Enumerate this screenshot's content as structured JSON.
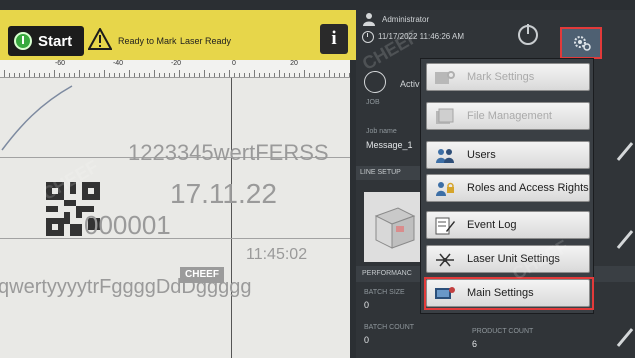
{
  "toolbar": {
    "start_label": "Start",
    "ready_label": "Ready to Mark",
    "laser_label": "Laser Ready",
    "info_label": "i"
  },
  "preview": {
    "ruler_labels": [
      "-60",
      "-40",
      "-20",
      "0",
      "20"
    ],
    "text_code": "1223345wertFERSS",
    "text_date": "17.11.22",
    "text_counter": "000001",
    "text_time": "11:45:02",
    "text_bottom": "qwertyyyytrFggggDdDggggg",
    "overlay_brand": "CHEEF"
  },
  "header": {
    "user": "Administrator",
    "datetime": "11/17/2022 11:46:26 AM"
  },
  "panel": {
    "active_label": "Activ",
    "job_label": "JOB",
    "job_name_label": "Job name",
    "job_name_value": "Message_1",
    "line_setup_label": "LINE SETUP",
    "performance_label": "PERFORMANC",
    "batch_size_label": "BATCH SIZE",
    "batch_size_value": "0",
    "batch_count_label": "BATCH COUNT",
    "batch_count_value": "0",
    "product_count_label": "PRODUCT COUNT",
    "product_count_value": "6"
  },
  "menu": {
    "items": [
      {
        "label": "Mark Settings",
        "icon": "mark-settings-icon",
        "enabled": false
      },
      {
        "label": "File Management",
        "icon": "file-management-icon",
        "enabled": false
      },
      {
        "label": "Users",
        "icon": "users-icon",
        "enabled": true
      },
      {
        "label": "Roles and Access Rights",
        "icon": "roles-icon",
        "enabled": true
      },
      {
        "label": "Event Log",
        "icon": "event-log-icon",
        "enabled": true
      },
      {
        "label": "Laser Unit Settings",
        "icon": "laser-unit-icon",
        "enabled": true
      },
      {
        "label": "Main Settings",
        "icon": "main-settings-icon",
        "enabled": true
      }
    ]
  },
  "watermark": "CHEEF",
  "colors": {
    "toolbar_yellow": "#e7d64a",
    "start_green": "#38a93f",
    "highlight_red": "#e23a3a",
    "panel_dark": "#303438"
  }
}
